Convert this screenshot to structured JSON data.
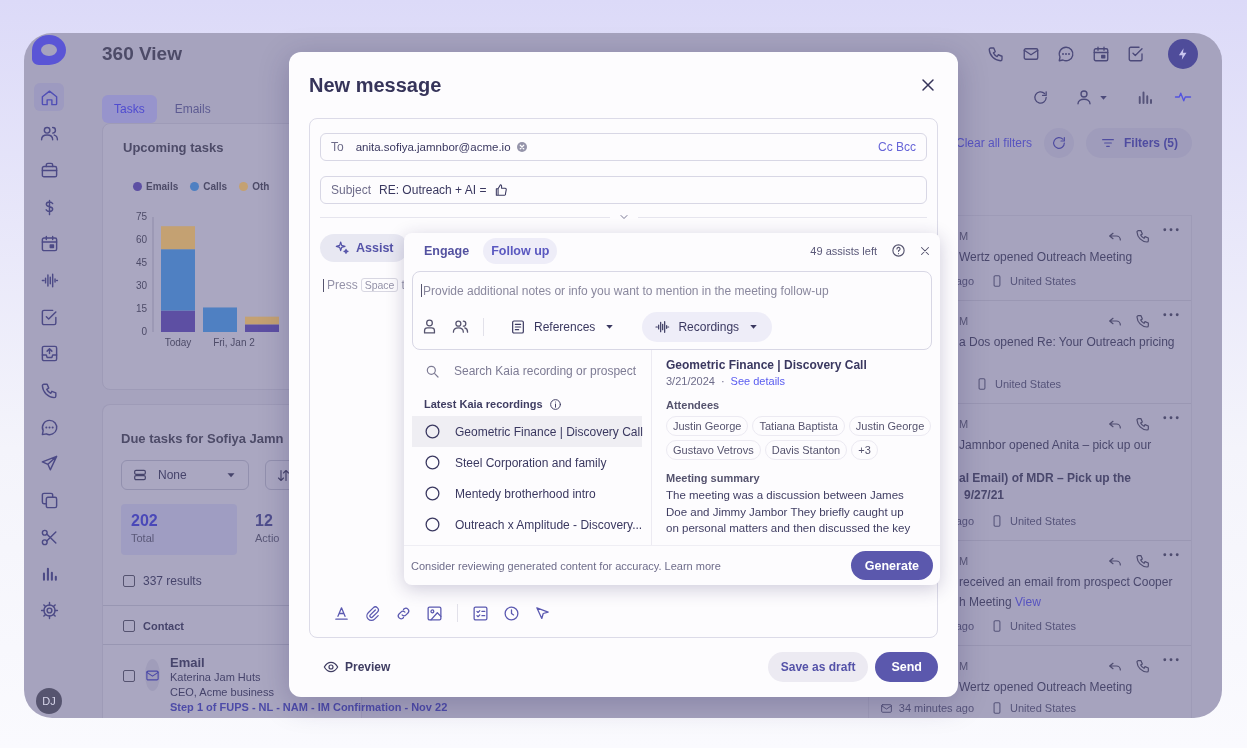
{
  "app": {
    "title": "360 View"
  },
  "sidebar": {
    "items": [
      {
        "selected": true
      },
      {
        "selected": false
      },
      {
        "selected": false
      },
      {
        "selected": false
      },
      {
        "selected": false
      },
      {
        "selected": false
      },
      {
        "selected": false
      },
      {
        "selected": false
      },
      {
        "selected": false
      },
      {
        "selected": false
      },
      {
        "selected": false
      },
      {
        "selected": false
      },
      {
        "selected": false
      },
      {
        "selected": false
      },
      {
        "selected": false
      }
    ],
    "avatar": "DJ"
  },
  "tabs": [
    {
      "label": "Tasks",
      "selected": true
    },
    {
      "label": "Emails",
      "selected": false
    }
  ],
  "upcoming": {
    "title": "Upcoming tasks",
    "chart_data": {
      "type": "bar",
      "stacked": true,
      "categories": [
        "Today",
        "Fri, Jan 2",
        null
      ],
      "yticks": [
        0,
        15,
        30,
        45,
        60,
        75
      ],
      "ylim": [
        0,
        75
      ],
      "series": [
        {
          "name": "Emails",
          "color": "#5d4fa3",
          "values": [
            14,
            0,
            5
          ]
        },
        {
          "name": "Calls",
          "color": "#4f80c2",
          "values": [
            40,
            16,
            0
          ]
        },
        {
          "name": "Oth",
          "color": "#c4a172",
          "values": [
            15,
            0,
            5
          ]
        }
      ]
    }
  },
  "due_tasks": {
    "title": "Due tasks for Sofiya Jamn",
    "group_by": "None",
    "stats": [
      {
        "value": "202",
        "label": "Total",
        "selected": true
      },
      {
        "value": "12",
        "label": "Actio",
        "selected": false
      }
    ],
    "results": {
      "label": "337 results",
      "checked": false
    },
    "column": {
      "label": "Contact",
      "checked": false
    },
    "row": {
      "checked": false,
      "type": "Email",
      "name": "Katerina Jam Huts",
      "title": "CEO, Acme business",
      "step": "Step 1 of FUPS - NL - NAM - IM Confirmation - Nov 22"
    }
  },
  "view_toggles": [
    {
      "selected": false
    },
    {
      "selected": true
    }
  ],
  "filters": {
    "clear": "Clear all filters",
    "button": "Filters (5)"
  },
  "feed": [
    {
      "time": "M",
      "lines": [
        {
          "text": "Wertz opened Outreach Meeting",
          "bold": false
        }
      ],
      "meta": [
        {
          "kind": "plain",
          "text": "ago"
        },
        {
          "kind": "device",
          "text": "United States"
        }
      ]
    },
    {
      "time": "M",
      "lines": [
        {
          "text": "a Dos opened Re: Your Outreach pricing",
          "bold": false
        }
      ],
      "meta": [
        {
          "kind": "device",
          "text": "United States"
        }
      ]
    },
    {
      "time": "M",
      "lines": [
        {
          "text": "Jamnbor opened Anita – pick up our",
          "bold": false
        },
        {
          "text": "al Email) of MDR – Pick up the",
          "bold": true
        },
        {
          "text": "9/27/21",
          "bold": true
        }
      ],
      "meta": [
        {
          "kind": "plain",
          "text": "ago"
        },
        {
          "kind": "device",
          "text": "United States"
        }
      ]
    },
    {
      "time": "M",
      "lines": [
        {
          "text": "received an email from prospect Cooper",
          "bold": false
        },
        {
          "text": "h Meeting",
          "bold": false,
          "link": "View"
        }
      ],
      "meta": [
        {
          "kind": "plain",
          "text": "ago"
        },
        {
          "kind": "device",
          "text": "United States"
        }
      ]
    },
    {
      "time": "M",
      "lines": [
        {
          "text": "Wertz opened Outreach Meeting",
          "bold": false
        }
      ],
      "meta": [
        {
          "kind": "email",
          "text": "34 minutes ago"
        },
        {
          "kind": "device",
          "text": "United States"
        }
      ]
    }
  ],
  "message": {
    "title": "New message",
    "to_label": "To",
    "recipients": [
      "anita.sofiya.jamnbor@acme.io"
    ],
    "cc_bcc": "Cc Bcc",
    "subject_label": "Subject",
    "subject": "RE: Outreach + AI =",
    "assist": "Assist",
    "prompt": {
      "before": "Press",
      "key": "Space",
      "after": "t"
    },
    "assistant": {
      "tabs": [
        {
          "label": "Engage",
          "selected": false
        },
        {
          "label": "Follow up",
          "selected": true
        }
      ],
      "remaining": "49 assists left",
      "notes_placeholder": "Provide additional notes or info you want to mention in the meeting follow-up",
      "sources": [
        {
          "label": "References",
          "selected": false
        },
        {
          "label": "Recordings",
          "selected": true
        }
      ],
      "search_placeholder": "Search Kaia recording or prospect",
      "list_title": "Latest Kaia recordings",
      "recordings": [
        {
          "name": "Geometric Finance | Discovery Call",
          "selected": true
        },
        {
          "name": "Steel Corporation and family",
          "selected": false
        },
        {
          "name": "Mentedy brotherhood intro",
          "selected": false
        },
        {
          "name": "Outreach x Amplitude - Discovery...",
          "selected": false
        }
      ],
      "detail": {
        "title": "Geometric Finance | Discovery Call",
        "date": "3/21/2024",
        "separator": "·",
        "link": "See details",
        "attendees_label": "Attendees",
        "attendees": [
          "Justin George",
          "Tatiana Baptista",
          "Justin George",
          "Gustavo Vetrovs",
          "Davis Stanton",
          "+3"
        ],
        "summary_label": "Meeting summary",
        "summary": "The meeting was a discussion between James Doe and Jimmy Jambor They briefly caught up on personal matters and then discussed the key"
      },
      "disclaimer": "Consider reviewing generated content for accuracy. Learn more",
      "generate": "Generate"
    },
    "preview": "Preview",
    "save_draft": "Save as draft",
    "send": "Send"
  }
}
